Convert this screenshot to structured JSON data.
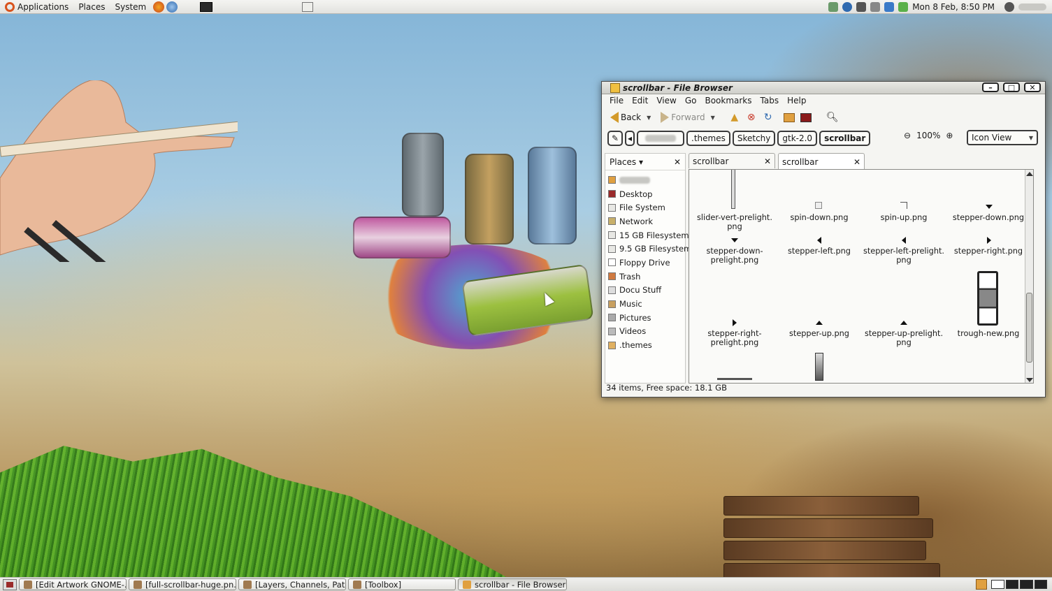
{
  "top_panel": {
    "menus": [
      "Applications",
      "Places",
      "System"
    ],
    "clock": "Mon  8 Feb,  8:50 PM"
  },
  "window": {
    "title": "scrollbar - File Browser",
    "menubar": [
      "File",
      "Edit",
      "View",
      "Go",
      "Bookmarks",
      "Tabs",
      "Help"
    ],
    "toolbar": {
      "back_label": "Back",
      "forward_label": "Forward"
    },
    "pathbar": {
      "crumbs": [
        ".themes",
        "Sketchy",
        "gtk-2.0",
        "scrollbar"
      ],
      "zoom_level": "100%",
      "view_mode": "Icon View"
    },
    "sidebar": {
      "header": "Places",
      "items": [
        "Desktop",
        "File System",
        "Network",
        "15 GB Filesystem",
        "9.5 GB Filesystem",
        "Floppy Drive",
        "Trash",
        "Docu Stuff",
        "Music",
        "Pictures",
        "Videos",
        ".themes"
      ]
    },
    "tabs": [
      "scrollbar",
      "scrollbar"
    ],
    "files": [
      "slider-vert-prelight.\npng",
      "spin-down.png",
      "spin-up.png",
      "stepper-down.png",
      "stepper-down-\nprelight.png",
      "stepper-left.png",
      "stepper-left-prelight.\npng",
      "stepper-right.png",
      "stepper-right-\nprelight.png",
      "stepper-up.png",
      "stepper-up-prelight.\npng",
      "trough-new.png"
    ],
    "status": "34 items, Free space: 18.1 GB"
  },
  "taskbar": [
    "[Edit Artwork GNOME-...",
    "[full-scrollbar-huge.pn...",
    "[Layers, Channels, Pat...",
    "[Toolbox]",
    "scrollbar - File Browser"
  ],
  "colors": {
    "accent_orange": "#d9541e",
    "panel": "#e8e8e4"
  }
}
